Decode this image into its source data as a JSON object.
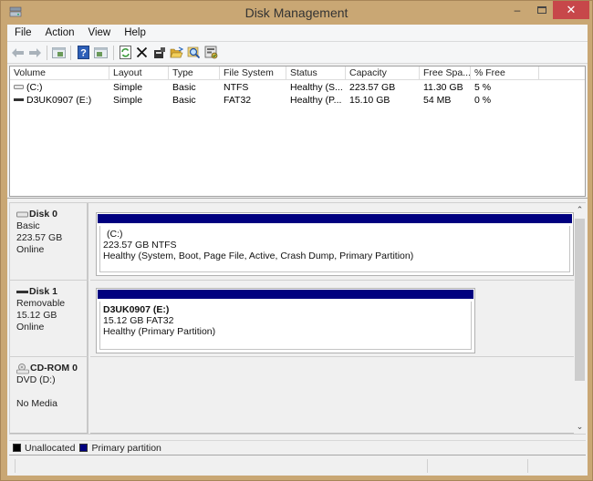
{
  "window": {
    "title": "Disk Management",
    "minimize_glyph": "–",
    "close_glyph": "✕"
  },
  "menu": [
    "File",
    "Action",
    "View",
    "Help"
  ],
  "toolbar": [
    {
      "name": "back-icon",
      "glyph": "⇦"
    },
    {
      "name": "forward-icon",
      "glyph": "⇨"
    },
    {
      "name": "show-hide-console-tree-icon",
      "glyph": ""
    },
    {
      "name": "help-icon",
      "glyph": "?"
    },
    {
      "name": "show-hide-action-pane-icon",
      "glyph": ""
    },
    {
      "name": "refresh-icon",
      "glyph": "⟳"
    },
    {
      "name": "delete-icon",
      "glyph": "✕"
    },
    {
      "name": "properties-icon",
      "glyph": ""
    },
    {
      "name": "open-icon",
      "glyph": ""
    },
    {
      "name": "explore-icon",
      "glyph": ""
    },
    {
      "name": "settings-icon",
      "glyph": ""
    }
  ],
  "volume_list": {
    "columns": [
      "Volume",
      "Layout",
      "Type",
      "File System",
      "Status",
      "Capacity",
      "Free Spa...",
      "% Free"
    ],
    "rows": [
      {
        "icon": "hard-drive-icon",
        "volume": "(C:)",
        "layout": "Simple",
        "type": "Basic",
        "fs": "NTFS",
        "status": "Healthy (S...",
        "capacity": "223.57 GB",
        "free": "11.30 GB",
        "pct": "5 %"
      },
      {
        "icon": "removable-drive-icon",
        "volume": "D3UK0907 (E:)",
        "layout": "Simple",
        "type": "Basic",
        "fs": "FAT32",
        "status": "Healthy (P...",
        "capacity": "15.10 GB",
        "free": "54 MB",
        "pct": "0 %"
      }
    ]
  },
  "disks": [
    {
      "name": "Disk 0",
      "kind": "Basic",
      "size": "223.57 GB",
      "state": "Online",
      "partition": {
        "label": "(C:)",
        "size_fs": "223.57 GB NTFS",
        "status": "Healthy (System, Boot, Page File, Active, Crash Dump, Primary Partition)"
      }
    },
    {
      "name": "Disk 1",
      "kind": "Removable",
      "size": "15.12 GB",
      "state": "Online",
      "partition": {
        "label": "D3UK0907  (E:)",
        "size_fs": "15.12 GB FAT32",
        "status": "Healthy (Primary Partition)"
      }
    },
    {
      "name": "CD-ROM 0",
      "kind": "DVD (D:)",
      "size": "",
      "state": "No Media"
    }
  ],
  "legend": [
    {
      "label": "Unallocated",
      "color": "#000000"
    },
    {
      "label": "Primary partition",
      "color": "#00007f"
    }
  ],
  "colors": {
    "primary_partition": "#00007f",
    "close_button": "#c7474a",
    "frame": "#c9a774"
  }
}
